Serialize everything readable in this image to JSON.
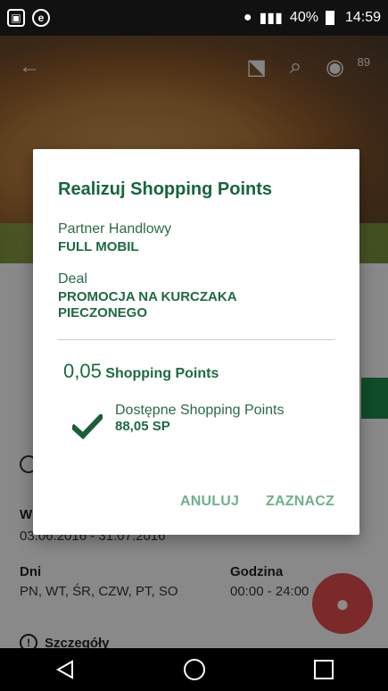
{
  "status_bar": {
    "battery": "40%",
    "time": "14:59"
  },
  "toolbar": {
    "badge_count": "89"
  },
  "behind": {
    "w_label": "W",
    "dates": "03.06.2016 - 31.07.2016",
    "dni_label": "Dni",
    "dni_value": "PN, WT, ŚR, CZW, PT, SO",
    "godzina_label": "Godzina",
    "godzina_value": "00:00 - 24:00",
    "szczegoly_label": "Szczegóły"
  },
  "dialog": {
    "title": "Realizuj Shopping Points",
    "partner_label": "Partner Handlowy",
    "partner_value": "FULL MOBIL",
    "deal_label": "Deal",
    "deal_value_line1": "PROMOCJA NA KURCZAKA",
    "deal_value_line2": "PIECZONEGO",
    "amount": "0,05",
    "amount_unit": "Shopping Points",
    "available_label": "Dostępne Shopping Points",
    "available_value": "88,05 SP",
    "cancel_label": "ANULUJ",
    "confirm_label": "ZAZNACZ"
  },
  "colors": {
    "primary_green": "#17653f",
    "action_green": "#6fb08d",
    "fab_red": "#e14b4b"
  }
}
